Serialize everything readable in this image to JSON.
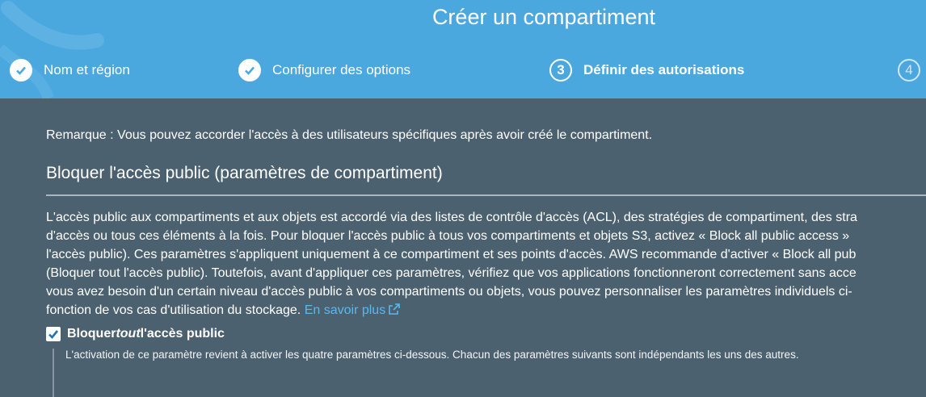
{
  "header": {
    "title": "Créer un compartiment",
    "steps": [
      {
        "label": "Nom et région",
        "state": "done",
        "num": ""
      },
      {
        "label": "Configurer des options",
        "state": "done",
        "num": ""
      },
      {
        "label": "Définir des autorisations",
        "state": "active",
        "num": "3"
      },
      {
        "label": "",
        "state": "future",
        "num": "4"
      }
    ]
  },
  "main": {
    "remark": "Remarque : Vous pouvez accorder l'accès à des utilisateurs spécifiques après avoir créé le compartiment.",
    "section_title": "Bloquer l'accès public (paramètres de compartiment)",
    "description_lines": [
      "L'accès public aux compartiments et aux objets est accordé via des listes de contrôle d'accès (ACL), des stratégies de compartiment, des stra",
      "d'accès ou tous ces éléments à la fois. Pour bloquer l'accès public à tous vos compartiments et objets S3, activez « Block all public access »",
      "l'accès public). Ces paramètres s'appliquent uniquement à ce compartiment et ses points d'accès. AWS recommande d'activer « Block all pub",
      "(Bloquer tout l'accès public). Toutefois, avant d'appliquer ces paramètres, vérifiez que vos applications fonctionneront correctement sans acce",
      "vous avez besoin d'un certain niveau d'accès public à vos compartiments ou objets, vous pouvez personnaliser les paramètres individuels ci-",
      "fonction de vos cas d'utilisation du stockage."
    ],
    "learn_more": "En savoir plus",
    "block_all": {
      "checked": true,
      "label_before": "Bloquer ",
      "label_em": "tout",
      "label_after": " l'accès public",
      "help": "L'activation de ce paramètre revient à activer les quatre paramètres ci-dessous. Chacun des paramètres suivants sont indépendants les uns des autres."
    }
  },
  "colors": {
    "header_bg": "#4aa8df",
    "content_bg": "#4c6170",
    "link": "#5ab8ee"
  }
}
